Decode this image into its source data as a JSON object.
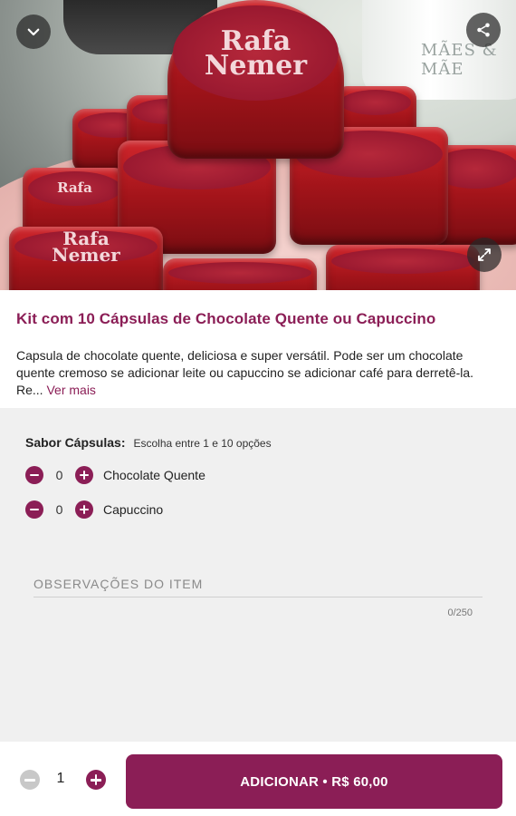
{
  "hero": {
    "brand_line1": "Rafa",
    "brand_line2": "Nemer",
    "mug_text": "MÃES & MÃE",
    "icons": {
      "collapse": "chevron-down-icon",
      "share": "share-icon",
      "expand": "expand-icon"
    }
  },
  "product": {
    "title": "Kit com 10 Cápsulas de Chocolate Quente ou Capuccino",
    "description_line1": "Capsula de chocolate quente, deliciosa e super versátil. Pode ser um chocolate",
    "description_line2": "quente cremoso se adicionar leite ou capuccino se adicionar café para derretê-la.",
    "description_line3": "Re...",
    "see_more": "Ver mais"
  },
  "options": {
    "label": "Sabor Cápsulas:",
    "hint": "Escolha entre 1 e 10 opções",
    "items": [
      {
        "name": "Chocolate Quente",
        "qty": "0"
      },
      {
        "name": "Capuccino",
        "qty": "0"
      }
    ]
  },
  "notes": {
    "placeholder": "OBSERVAÇÕES DO ITEM",
    "counter": "0/250"
  },
  "footer": {
    "qty": "1",
    "add_label": "ADICIONAR • R$ 60,00"
  },
  "colors": {
    "accent": "#8b1e56",
    "disabled": "#c8c8c8",
    "background": "#f0f0f0"
  }
}
